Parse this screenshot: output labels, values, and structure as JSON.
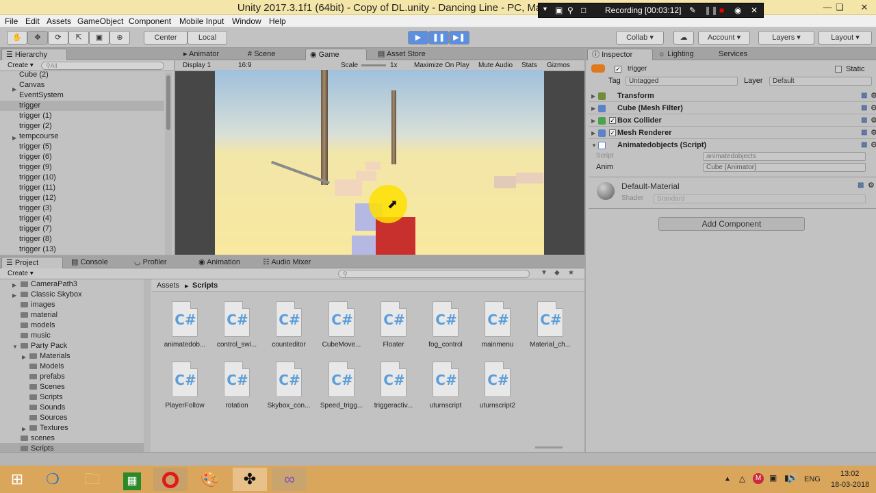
{
  "window": {
    "title": "Unity 2017.3.1f1 (64bit) - Copy of DL.unity - Dancing Line - PC, Mac & Linux Standalone",
    "minimize_icon": "minimize-icon",
    "maximize_icon": "restore-icon",
    "close_icon": "close-icon"
  },
  "recording": {
    "label": "Recording [00:03:12]"
  },
  "menu": [
    "File",
    "Edit",
    "Assets",
    "GameObject",
    "Component",
    "Mobile Input",
    "Window",
    "Help"
  ],
  "toolbar": {
    "pivot_label": "Center",
    "space_label": "Local",
    "collab_label": "Collab",
    "account_label": "Account",
    "layers_label": "Layers",
    "layout_label": "Layout"
  },
  "hierarchy": {
    "tab_label": "Hierarchy",
    "create_label": "Create",
    "search_placeholder": "All",
    "items": [
      "Cube (2)",
      "Canvas",
      "EventSystem",
      "trigger",
      "trigger (1)",
      "trigger (2)",
      "tempcourse",
      "trigger (5)",
      "trigger (6)",
      "trigger (9)",
      "trigger (10)",
      "trigger (11)",
      "trigger (12)",
      "trigger (3)",
      "trigger (4)",
      "trigger (7)",
      "trigger (8)",
      "trigger (13)"
    ]
  },
  "center_tabs": [
    "Animator",
    "Scene",
    "Game",
    "Asset Store"
  ],
  "game_bar": {
    "display": "Display 1",
    "aspect": "16:9",
    "scale_label": "Scale",
    "scale_value": "1x",
    "maximize": "Maximize On Play",
    "mute": "Mute Audio",
    "stats": "Stats",
    "gizmos": "Gizmos"
  },
  "inspector": {
    "tabs": [
      "Inspector",
      "Lighting",
      "Services"
    ],
    "object_name": "trigger",
    "static_label": "Static",
    "tag_label": "Tag",
    "tag_value": "Untagged",
    "layer_label": "Layer",
    "layer_value": "Default",
    "components": [
      "Transform",
      "Cube (Mesh Filter)",
      "Box Collider",
      "Mesh Renderer",
      "Animatedobjects (Script)"
    ],
    "script_label": "Script",
    "script_value": "animatedobjects",
    "anim_label": "Anim",
    "anim_value": "Cube (Animator)",
    "material_name": "Default-Material",
    "shader_label": "Shader",
    "shader_value": "Standard",
    "add_component": "Add Component"
  },
  "bottom_tabs": [
    "Project",
    "Console",
    "Profiler",
    "Animation",
    "Audio Mixer"
  ],
  "project": {
    "create_label": "Create",
    "folders": [
      "CameraPath3",
      "Classic Skybox",
      "images",
      "material",
      "models",
      "music",
      "Party Pack",
      "Materials",
      "Models",
      "prefabs",
      "Scenes",
      "Scripts",
      "Sounds",
      "Sources",
      "Textures",
      "scenes",
      "Scripts"
    ],
    "breadcrumb_root": "Assets",
    "breadcrumb_current": "Scripts",
    "assets": [
      "animatedob...",
      "control_swi...",
      "counteditor",
      "CubeMove...",
      "Floater",
      "fog_control",
      "mainmenu",
      "Material_ch...",
      "PlayerFollow",
      "rotation",
      "Skybox_con...",
      "Speed_trigg...",
      "triggeractiv...",
      "uturnscript",
      "uturnscript2"
    ],
    "cs_glyph": "C#"
  },
  "taskbar": {
    "lang": "ENG",
    "time": "13:02",
    "date": "18-03-2018"
  }
}
